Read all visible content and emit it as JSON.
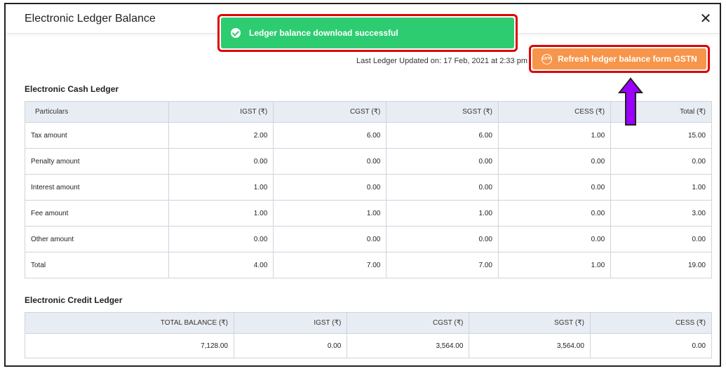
{
  "modal": {
    "title": "Electronic Ledger Balance",
    "close_label": "✕"
  },
  "toast": {
    "message": "Ledger balance download successful",
    "color": "#2ecc71"
  },
  "last_updated": "Last Ledger Updated on: 17 Feb, 2021 at 2:33 pm",
  "refresh": {
    "label": "Refresh ledger balance form GSTN",
    "icon_text": "GSTN",
    "color": "#f7954a"
  },
  "cash_ledger": {
    "title": "Electronic Cash Ledger",
    "headers": [
      "Particulars",
      "IGST (₹)",
      "CGST (₹)",
      "SGST (₹)",
      "CESS (₹)",
      "Total (₹)"
    ],
    "rows": [
      [
        "Tax amount",
        "2.00",
        "6.00",
        "6.00",
        "1.00",
        "15.00"
      ],
      [
        "Penalty amount",
        "0.00",
        "0.00",
        "0.00",
        "0.00",
        "0.00"
      ],
      [
        "Interest amount",
        "1.00",
        "0.00",
        "0.00",
        "0.00",
        "1.00"
      ],
      [
        "Fee amount",
        "1.00",
        "1.00",
        "1.00",
        "0.00",
        "3.00"
      ],
      [
        "Other amount",
        "0.00",
        "0.00",
        "0.00",
        "0.00",
        "0.00"
      ],
      [
        "Total",
        "4.00",
        "7.00",
        "7.00",
        "1.00",
        "19.00"
      ]
    ]
  },
  "credit_ledger": {
    "title": "Electronic Credit Ledger",
    "headers": [
      "TOTAL BALANCE (₹)",
      "IGST (₹)",
      "CGST (₹)",
      "SGST (₹)",
      "CESS (₹)"
    ],
    "rows": [
      [
        "7,128.00",
        "0.00",
        "3,564.00",
        "3,564.00",
        "0.00"
      ]
    ]
  },
  "annotation": {
    "highlight_color": "#e00000",
    "arrow_color": "#9b00ff"
  }
}
